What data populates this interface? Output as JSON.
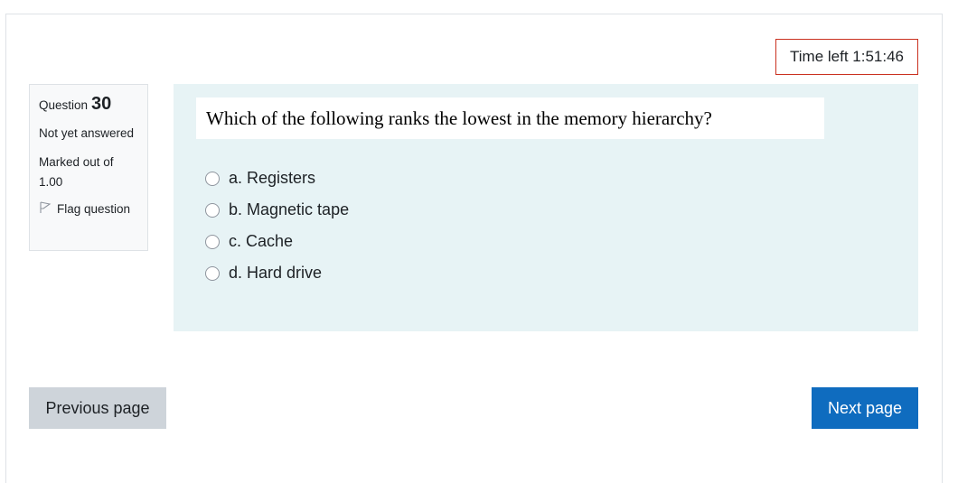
{
  "timer": {
    "label": "Time left",
    "value": "1:51:46",
    "text": "Time left 1:51:46"
  },
  "question_info": {
    "label": "Question",
    "number": "30",
    "state": "Not yet answered",
    "grade": "Marked out of 1.00",
    "flag_label": "Flag question"
  },
  "question": {
    "text": "Which of the following ranks the lowest in the memory hierarchy?",
    "answers": [
      {
        "label": "a. Registers",
        "selected": false
      },
      {
        "label": "b. Magnetic tape",
        "selected": false
      },
      {
        "label": "c. Cache",
        "selected": false
      },
      {
        "label": "d. Hard drive",
        "selected": false
      }
    ]
  },
  "navigation": {
    "previous_label": "Previous page",
    "next_label": "Next page"
  },
  "colors": {
    "accent": "#0f6cbf",
    "timer_border": "#ca3120",
    "content_bg": "#e7f3f5"
  }
}
